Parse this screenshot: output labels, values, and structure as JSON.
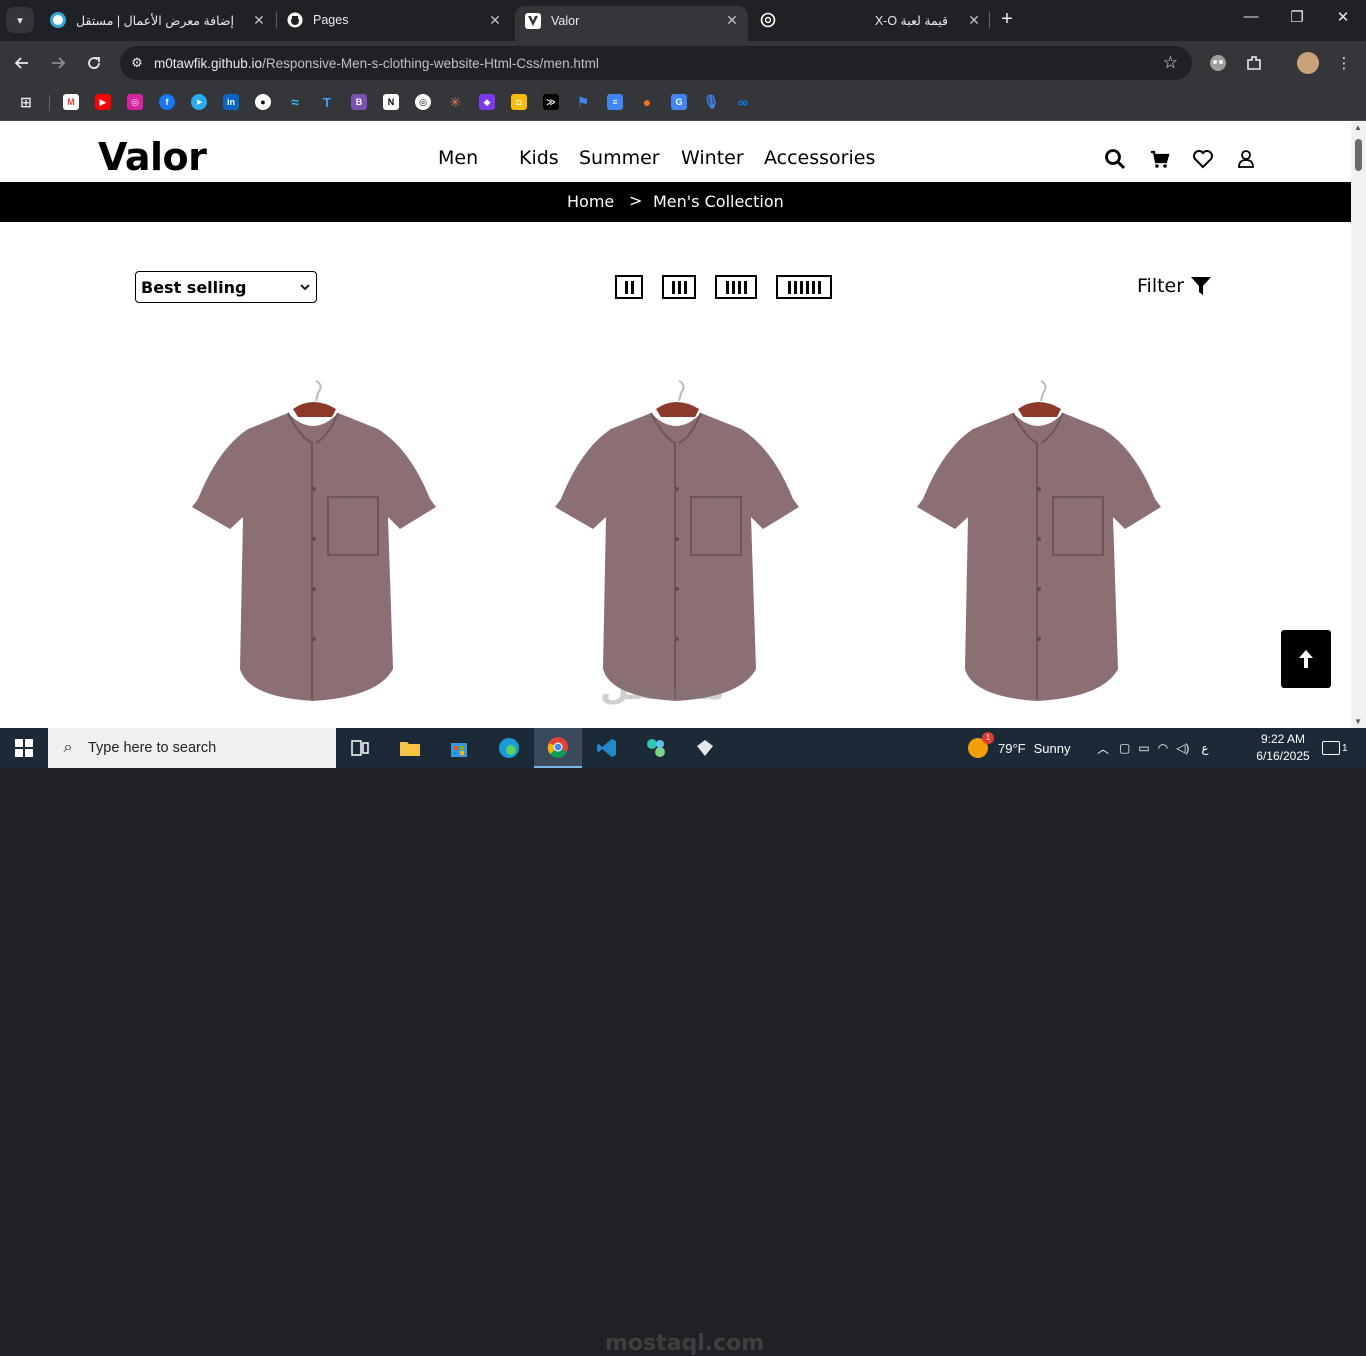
{
  "browser": {
    "tabs": [
      {
        "title": "إضافة معرض الأعمال | مستقل",
        "favicon_color": "#2fa8e0"
      },
      {
        "title": "Pages",
        "favicon_color": "#ffffff"
      },
      {
        "title": "Valor",
        "favicon_color": "#ffffff",
        "active": true
      },
      {
        "title": "قيمة لعبة X-O",
        "favicon_color": "#ffffff"
      }
    ],
    "url_host": "m0tawfik.github.io",
    "url_path": "/Responsive-Men-s-clothing-website-Html-Css/men.html",
    "bookmark_icons": [
      "gmail-icon",
      "youtube-icon",
      "instagram-icon",
      "facebook-icon",
      "telegram-icon",
      "linkedin-icon",
      "github-icon",
      "tailwind-icon",
      "tutorial-icon",
      "bootstrap-icon",
      "notion-icon",
      "openai-icon",
      "claude-icon",
      "copilot-icon",
      "keep-icon",
      "terminal-icon",
      "flag-icon",
      "forms-icon",
      "pumpkin-icon",
      "translate-icon",
      "microphone-icon",
      "meta-icon"
    ]
  },
  "site": {
    "logo": "Valor",
    "nav": [
      "Men",
      "Kids",
      "Summer",
      "Winter",
      "Accessories"
    ],
    "breadcrumb": {
      "home": "Home",
      "separator": ">",
      "current": "Men's Collection"
    },
    "sort": {
      "selected": "Best selling"
    },
    "filter_label": "Filter",
    "products": [
      {
        "name": "shirt",
        "color": "#8b6f72"
      },
      {
        "name": "shirt",
        "color": "#8b6f72"
      },
      {
        "name": "shirt",
        "color": "#8b6f72"
      }
    ],
    "watermark_top": "مستقل",
    "watermark_bottom": "mostaql.com"
  },
  "taskbar": {
    "search_placeholder": "Type here to search",
    "weather_temp": "79°F",
    "weather_text": "Sunny",
    "weather_badge": "1",
    "lang": "ع",
    "time": "9:22 AM",
    "date": "6/16/2025",
    "notif_count": "1"
  }
}
